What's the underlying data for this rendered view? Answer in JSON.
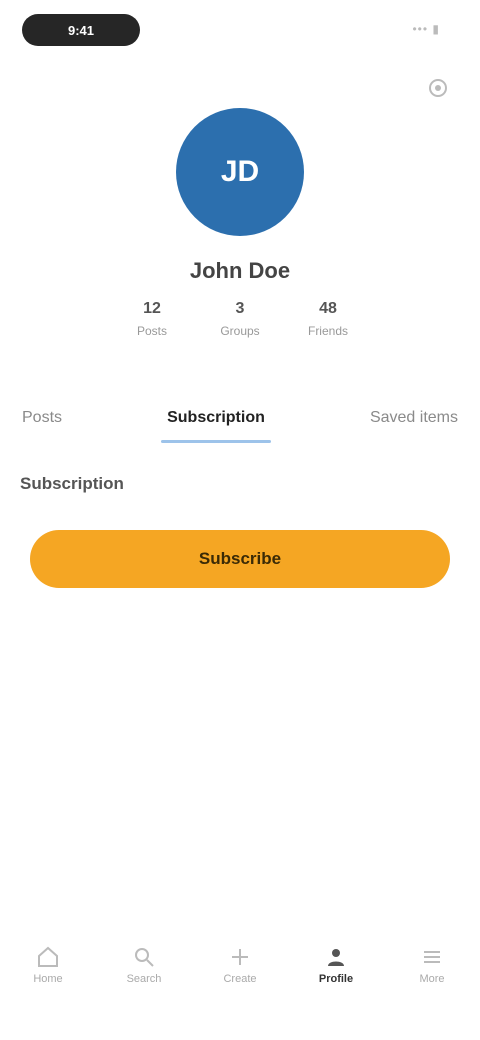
{
  "status_bar": {
    "time": "9:41",
    "right": "••• ▮"
  },
  "profile": {
    "initials": "JD",
    "username": "John Doe",
    "stats": [
      {
        "value": "12",
        "label": "Posts"
      },
      {
        "value": "3",
        "label": "Groups"
      },
      {
        "value": "48",
        "label": "Friends"
      }
    ]
  },
  "tabs": [
    "Posts",
    "Subscription",
    "Saved items"
  ],
  "active_tab": 1,
  "section": {
    "label": "Subscription"
  },
  "primary_button": {
    "label": "Subscribe"
  },
  "bottom_nav": [
    {
      "icon": "home-icon",
      "label": "Home"
    },
    {
      "icon": "search-icon",
      "label": "Search"
    },
    {
      "icon": "plus-icon",
      "label": "Create"
    },
    {
      "icon": "profile-icon",
      "label": "Profile"
    },
    {
      "icon": "menu-icon",
      "label": "More"
    }
  ],
  "colors": {
    "accent": "#f5a623",
    "avatar": "#2c6fae",
    "tab_indicator": "#9dc3ea"
  }
}
